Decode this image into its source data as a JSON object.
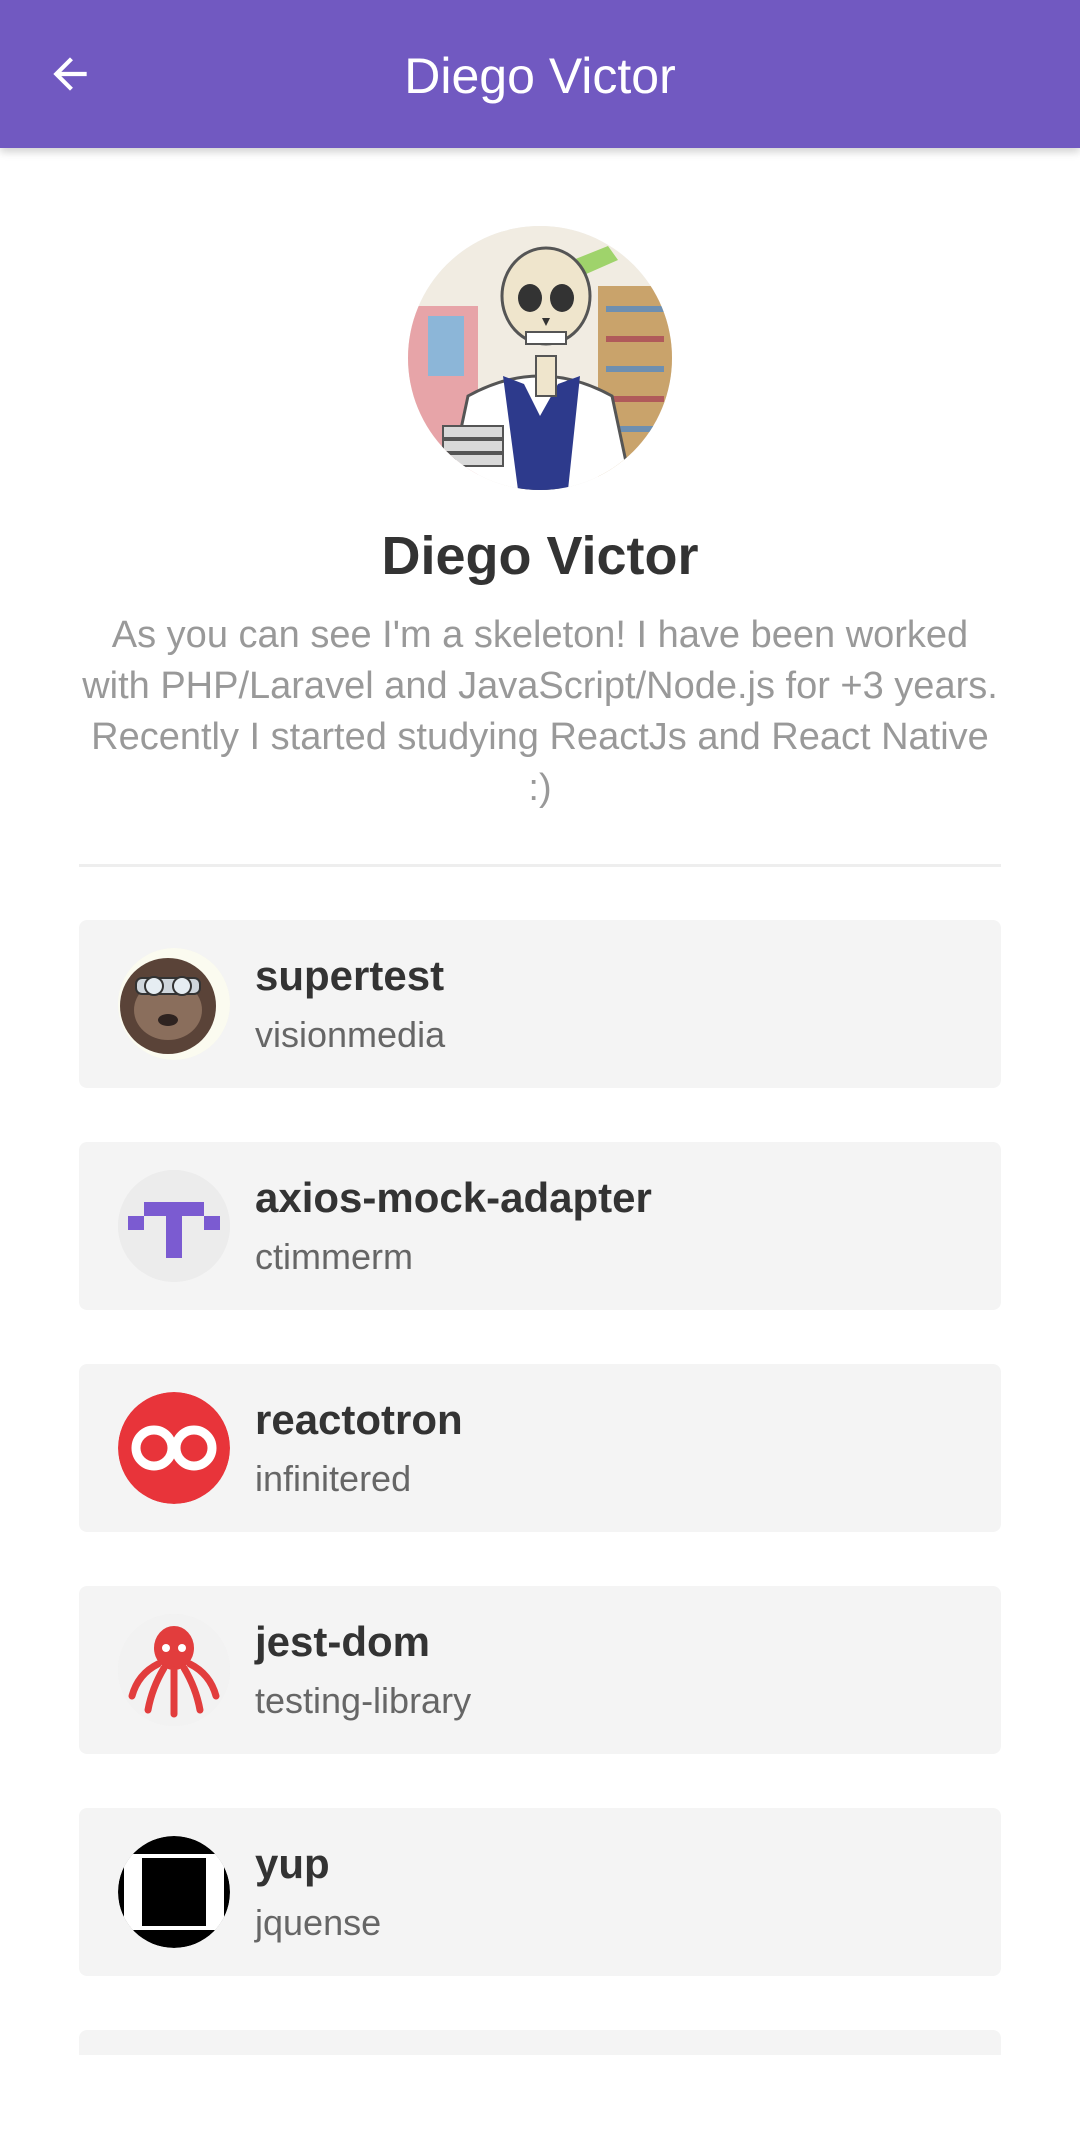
{
  "header": {
    "title": "Diego Victor",
    "back_icon": "arrow-left-icon",
    "background_color": "#7159c1"
  },
  "profile": {
    "name": "Diego Victor",
    "bio": "As you can see I'm a skeleton! I have been worked with PHP/Laravel and JavaScript/Node.js for +3 years. Recently I started studying ReactJs and React Native :)",
    "avatar_icon": "skeleton-avatar"
  },
  "starred": [
    {
      "title": "supertest",
      "author": "visionmedia",
      "avatar_icon": "sloth-avatar"
    },
    {
      "title": "axios-mock-adapter",
      "author": "ctimmerm",
      "avatar_icon": "identicon-avatar"
    },
    {
      "title": "reactotron",
      "author": "infinitered",
      "avatar_icon": "infinitered-logo"
    },
    {
      "title": "jest-dom",
      "author": "testing-library",
      "avatar_icon": "octopus-avatar"
    },
    {
      "title": "yup",
      "author": "jquense",
      "avatar_icon": "square-avatar"
    }
  ],
  "colors": {
    "accent": "#7159c1",
    "card": "#f4f4f4",
    "text": "#333333",
    "muted": "#999999"
  }
}
